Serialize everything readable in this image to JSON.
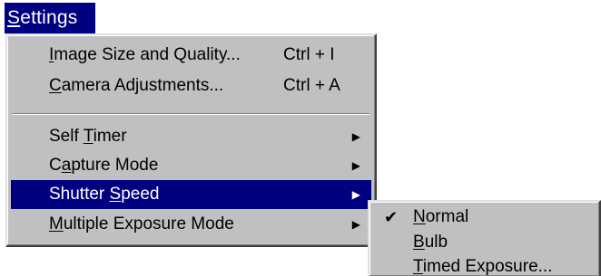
{
  "menubar": {
    "settings": {
      "pre": "",
      "mn": "S",
      "post": "ettings"
    }
  },
  "settings_menu": {
    "items": [
      {
        "pre": "",
        "mn": "I",
        "post": "mage Size and Quality...",
        "shortcut": "Ctrl + I"
      },
      {
        "pre": "",
        "mn": "C",
        "post": "amera Adjustments...",
        "shortcut": "Ctrl + A"
      },
      {
        "pre": "Self ",
        "mn": "T",
        "post": "imer",
        "arrow": "▶"
      },
      {
        "pre": "C",
        "mn": "a",
        "post": "pture Mode",
        "arrow": "▶"
      },
      {
        "pre": "Shutter ",
        "mn": "S",
        "post": "peed",
        "arrow": "▶"
      },
      {
        "pre": "",
        "mn": "M",
        "post": "ultiple Exposure Mode",
        "arrow": "▶"
      }
    ]
  },
  "shutter_speed_submenu": {
    "items": [
      {
        "pre": "",
        "mn": "N",
        "post": "ormal",
        "check": "✔"
      },
      {
        "pre": "",
        "mn": "B",
        "post": "ulb"
      },
      {
        "pre": "",
        "mn": "T",
        "post": "imed Exposure..."
      }
    ]
  },
  "colors": {
    "menu_face": "#c0c0c0",
    "highlight": "#000080",
    "highlight_text": "#ffffff"
  }
}
